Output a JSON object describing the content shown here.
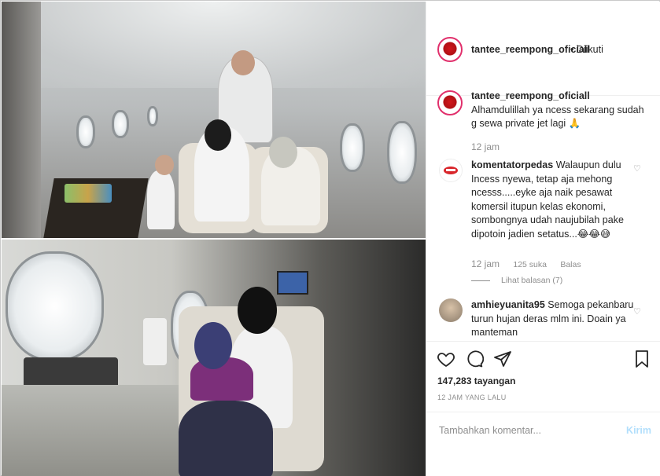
{
  "post": {
    "username": "tantee_reempong_oficiall",
    "follow_status": "• Diikuti",
    "caption_username": "tantee_reempong_oficiall",
    "caption_text": "Alhamdulillah ya ncess sekarang sudah g sewa private jet lagi 🙏",
    "caption_time": "12 jam"
  },
  "comments": [
    {
      "username": "komentatorpedas",
      "text": "Walaupun dulu Incess nyewa, tetap aja mehong ncesss.....eyke aja naik pesawat komersil itupun kelas ekonomi, sombongnya udah naujubilah pake dipotoin jadien setatus...😂😂😅",
      "time": "12 jam",
      "likes": "125 suka",
      "reply_label": "Balas",
      "view_replies": "Lihat balasan (7)"
    },
    {
      "username": "amhieyuanita95",
      "text": "Semoga pekanbaru turun hujan deras mlm ini. Doain ya manteman"
    }
  ],
  "stats": {
    "views": "147,283 tayangan",
    "posted_ago": "12 JAM YANG LALU"
  },
  "comment_box": {
    "placeholder": "Tambahkan komentar...",
    "send_label": "Kirim"
  },
  "icons": {
    "like": "heart-icon",
    "comment": "comment-icon",
    "share": "share-icon",
    "save": "bookmark-icon"
  },
  "colors": {
    "accent": "#e1306c",
    "send_disabled": "#b2dffc",
    "muted_text": "#8e8e8e"
  }
}
